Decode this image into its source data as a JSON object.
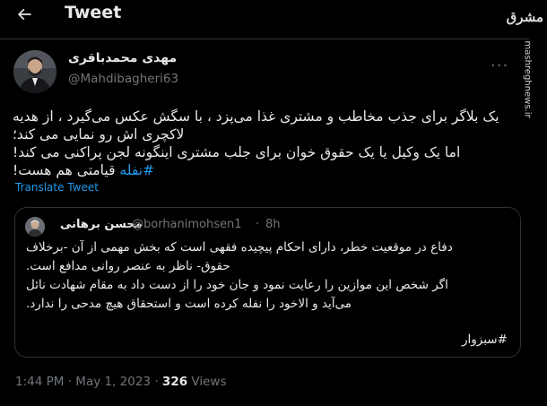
{
  "header": {
    "title": "Tweet",
    "back_icon": "arrow-left-icon"
  },
  "author": {
    "name": "مهدی محمدباقری",
    "handle": "@Mahdibagheri63"
  },
  "more_icon": "more-horizontal-icon",
  "tweet": {
    "lines": [
      "یک بلاگر برای جذب مخاطب و مشتری غذا می‌پزد ، با سگش عکس می‌گیرد ، از هدیه",
      "لاکچری اش رو نمایی می کند؛",
      "اما یک وکیل یا یک حقوق خوان برای جلب مشتری اینگونه لجن پراکنی می کند!"
    ],
    "hashtag": "#نفله",
    "last_line_rest": " قیامتی هم هست!"
  },
  "translate_label": "Translate Tweet",
  "quote": {
    "name": "محسن برهانی",
    "handle": "@borhanimohsen1",
    "dot": "·",
    "time": "8h",
    "lines": [
      "دفاع در موقعیت خطر، دارای احکام پیچیده فقهی است که بخش مهمی از آن -برخلاف",
      "حقوق- ناظر به عنصر روانی مدافع است.",
      "اگر شخص این موازین را رعایت نمود و جان خود را از دست داد به مقام شهادت نائل",
      "می‌آید و الاخود را نفله کرده است و استحقاق هیچ مدحی را ندارد."
    ],
    "hashtag": "#سبزوار"
  },
  "meta": {
    "time": "1:44 PM",
    "dot": "·",
    "date": "May 1, 2023",
    "views_count": "326",
    "views_label": "Views"
  },
  "watermark": {
    "logo": "مشرق",
    "url": "mashreghnews.ir"
  }
}
